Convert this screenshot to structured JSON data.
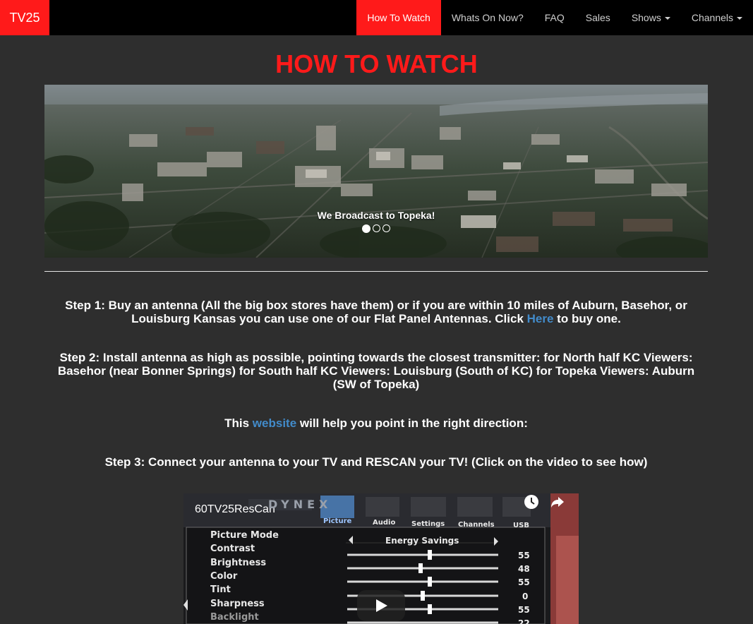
{
  "navbar": {
    "brand": "TV25",
    "items": [
      {
        "label": "How To Watch",
        "active": true
      },
      {
        "label": "Whats On Now?"
      },
      {
        "label": "FAQ"
      },
      {
        "label": "Sales"
      },
      {
        "label": "Shows",
        "dropdown": true
      },
      {
        "label": "Channels",
        "dropdown": true
      }
    ],
    "active_color": "#ff1a1a"
  },
  "page_title": "HOW TO WATCH",
  "carousel": {
    "caption": "We Broadcast to Topeka!",
    "slide_count": 3,
    "active_slide": 1
  },
  "steps": {
    "step1_pre": "Step 1: Buy an antenna (All the big box stores have them) or if you are within 10 miles of Auburn, Basehor, or Louisburg Kansas you can use one of our Flat Panel Antennas. Click ",
    "step1_link": "Here",
    "step1_post": " to buy one.",
    "step2": "Step 2: Install antenna as high as possible, pointing towards the closest transmitter: for North half KC Viewers: Basehor (near Bonner Springs) for South half KC Viewers: Louisburg (South of KC) for Topeka Viewers: Auburn (SW of Topeka)",
    "website_pre": "This ",
    "website_link": "website",
    "website_post": " will help you point in the right direction:",
    "step3": "Step 3: Connect your antenna to your TV and RESCAN your TV! (Click on the video to see how)"
  },
  "video": {
    "title": "60TV25ResCan",
    "brand": "DYNEX",
    "menu_tabs": [
      "Picture",
      "Audio",
      "Settings",
      "Channels",
      "USB"
    ],
    "picture_mode_label": "Picture Mode",
    "picture_mode_value": "Energy Savings",
    "settings": [
      {
        "label": "Contrast",
        "value": "55"
      },
      {
        "label": "Brightness",
        "value": "48"
      },
      {
        "label": "Color",
        "value": "55"
      },
      {
        "label": "Tint",
        "value": "0"
      },
      {
        "label": "Sharpness",
        "value": "55"
      },
      {
        "label": "Backlight",
        "value": "22"
      }
    ],
    "icons": [
      "clock-icon",
      "share-icon",
      "play-icon"
    ]
  },
  "link_color": "#428bca"
}
